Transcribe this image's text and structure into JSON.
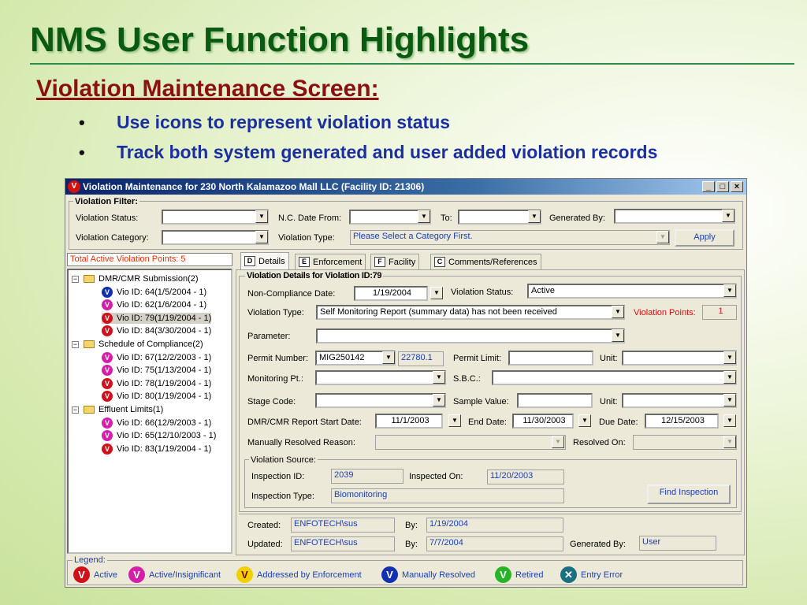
{
  "slide": {
    "title": "NMS User Function Highlights",
    "subtitle": "Violation Maintenance Screen:",
    "bullets": [
      "Use icons to represent violation status",
      "Track both system generated and user added violation records"
    ]
  },
  "window": {
    "title": "Violation Maintenance for 230 North Kalamazoo Mall LLC (Facility ID: 21306)",
    "title_icon": "V",
    "buttons": {
      "minimize": "_",
      "maximize": "□",
      "close": "×"
    }
  },
  "filter": {
    "group_label": "Violation Filter:",
    "violation_status_label": "Violation  Status:",
    "violation_status_value": "",
    "nc_date_from_label": "N.C. Date From:",
    "nc_date_from_value": "",
    "to_label": "To:",
    "to_value": "",
    "generated_by_label": "Generated By:",
    "generated_by_value": "",
    "violation_category_label": "Violation  Category:",
    "violation_category_value": "",
    "violation_type_label": "Violation  Type:",
    "violation_type_value": "Please Select  a Category First.",
    "apply_label": "Apply"
  },
  "tree": {
    "points_label": "Total Active Violation Points: 5",
    "groups": [
      {
        "label": "DMR/CMR Submission(2)",
        "items": [
          {
            "label": "Vio ID: 64(1/5/2004 - 1)",
            "status": "manual"
          },
          {
            "label": "Vio ID: 62(1/6/2004 - 1)",
            "status": "insig"
          },
          {
            "label": "Vio ID: 79(1/19/2004 - 1)",
            "status": "active",
            "selected": true
          },
          {
            "label": "Vio ID: 84(3/30/2004 - 1)",
            "status": "active"
          }
        ]
      },
      {
        "label": "Schedule of Compliance(2)",
        "items": [
          {
            "label": "Vio ID: 67(12/2/2003 - 1)",
            "status": "insig"
          },
          {
            "label": "Vio ID: 75(1/13/2004 - 1)",
            "status": "insig"
          },
          {
            "label": "Vio ID: 78(1/19/2004 - 1)",
            "status": "active"
          },
          {
            "label": "Vio ID: 80(1/19/2004 - 1)",
            "status": "active"
          }
        ]
      },
      {
        "label": "Effluent Limits(1)",
        "items": [
          {
            "label": "Vio ID: 66(12/9/2003 - 1)",
            "status": "insig"
          },
          {
            "label": "Vio ID: 65(12/10/2003 - 1)",
            "status": "insig"
          },
          {
            "label": "Vio ID: 83(1/19/2004 - 1)",
            "status": "active"
          }
        ]
      }
    ]
  },
  "tabs": [
    {
      "label": "Details",
      "icon": "D"
    },
    {
      "label": "Enforcement",
      "icon": "E"
    },
    {
      "label": "Facility",
      "icon": "F"
    },
    {
      "label": "Comments/References",
      "icon": "C"
    }
  ],
  "details": {
    "group_label": "Violation Details for Violation ID:79",
    "nc_date_label": "Non-Compliance Date:",
    "nc_date_value": "1/19/2004",
    "status_label": "Violation  Status:",
    "status_value": "Active",
    "type_label": "Violation  Type:",
    "type_value": "Self Monitoring Report (summary data) has not been received",
    "points_label": "Violation Points:",
    "points_value": "1",
    "parameter_label": "Parameter:",
    "parameter_value": "",
    "permit_number_label": "Permit Number:",
    "permit_number_value": "MIG250142",
    "permit_number_code": "22780.1",
    "permit_limit_label": "Permit Limit:",
    "permit_limit_value": "",
    "unit_label": "Unit:",
    "unit_value": "",
    "monitoring_pt_label": "Monitoring Pt.:",
    "monitoring_pt_value": "",
    "sbc_label": "S.B.C.:",
    "sbc_value": "",
    "stage_code_label": "Stage Code:",
    "stage_code_value": "",
    "sample_value_label": "Sample Value:",
    "sample_value_value": "",
    "unit2_label": "Unit:",
    "unit2_value": "",
    "report_start_label": "DMR/CMR Report Start Date:",
    "report_start_value": "11/1/2003",
    "end_date_label": "End Date:",
    "end_date_value": "11/30/2003",
    "due_date_label": "Due Date:",
    "due_date_value": "12/15/2003",
    "resolved_reason_label": "Manually Resolved Reason:",
    "resolved_reason_value": "",
    "resolved_on_label": "Resolved On:",
    "resolved_on_value": ""
  },
  "source": {
    "group_label": "Violation Source:",
    "inspection_id_label": "Inspection ID:",
    "inspection_id_value": "2039",
    "inspected_on_label": "Inspected On:",
    "inspected_on_value": "11/20/2003",
    "inspection_type_label": "Inspection Type:",
    "inspection_type_value": "Biomonitoring",
    "find_inspection_label": "Find Inspection"
  },
  "audit": {
    "created_label": "Created:",
    "created_by_value": "ENFOTECH\\sus",
    "by_label": "By:",
    "created_date": "1/19/2004",
    "updated_label": "Updated:",
    "updated_by_value": "ENFOTECH\\sus",
    "updated_date": "7/7/2004",
    "generated_by_label": "Generated By:",
    "generated_by_value": "User"
  },
  "legend": {
    "label": "Legend:",
    "items": [
      {
        "label": "Active",
        "status": "active"
      },
      {
        "label": "Active/Insignificant",
        "status": "insig"
      },
      {
        "label": "Addressed by Enforcement",
        "status": "addr"
      },
      {
        "label": "Manually Resolved",
        "status": "manual"
      },
      {
        "label": "Retired",
        "status": "retired"
      },
      {
        "label": "Entry Error",
        "status": "error"
      }
    ]
  },
  "colors": {
    "active": "#d0101a",
    "insignificant": "#d61fa8",
    "addressed": "#f0d000",
    "manual": "#1230b0",
    "retired": "#28b428",
    "error": "#1a6f80",
    "title_green": "#0b5a12",
    "subtitle_red": "#8b1010",
    "bullet_blue": "#1a2fa0"
  }
}
